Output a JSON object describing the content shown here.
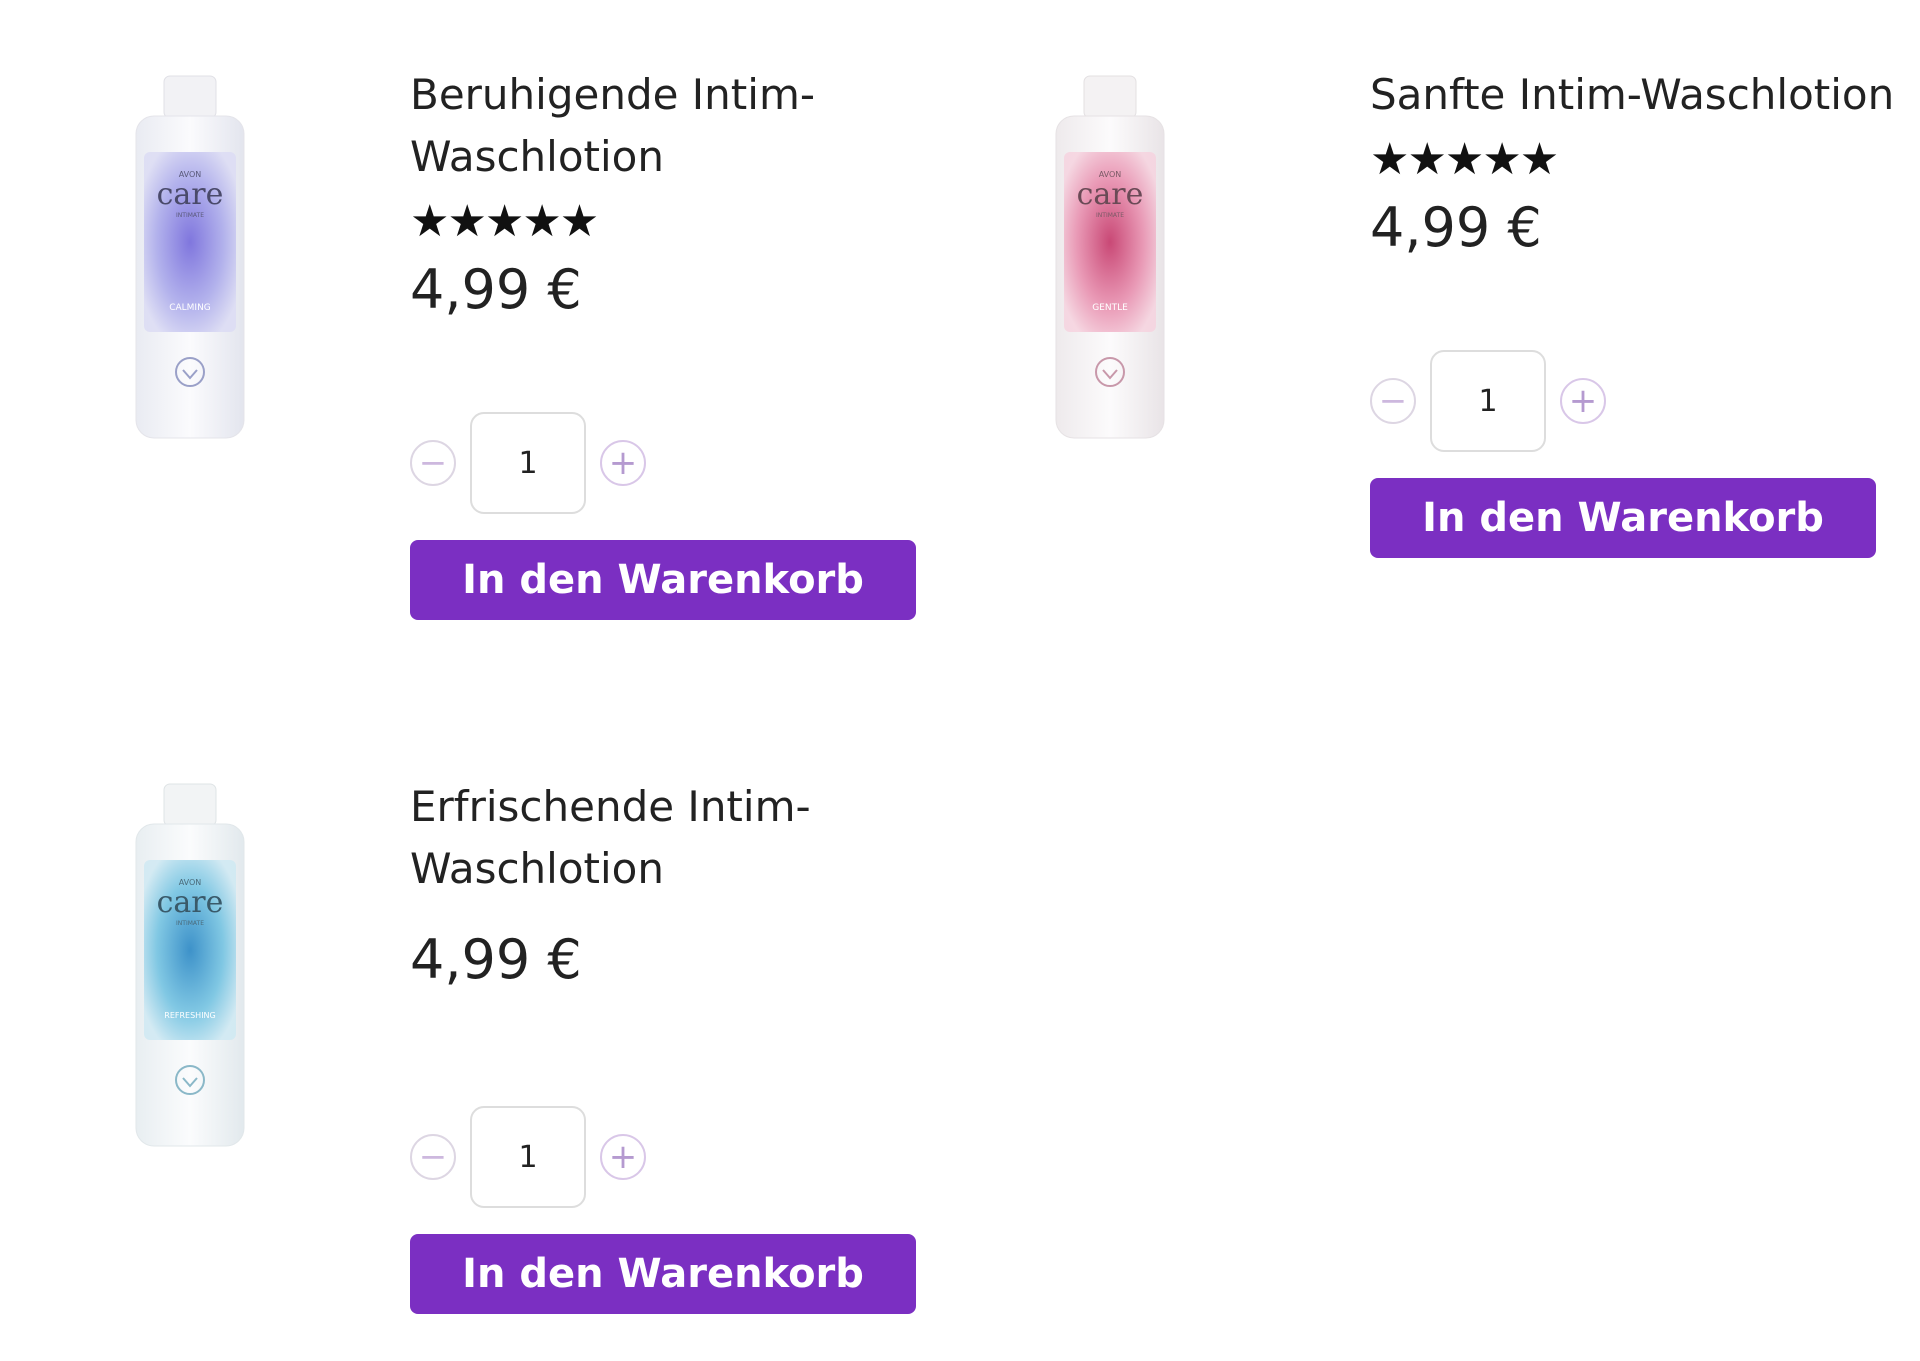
{
  "products": [
    {
      "title": "Beruhigende Intim-Waschlotion",
      "stars": "★★★★★",
      "rating": 5,
      "price": "4,99 €",
      "quantity": "1",
      "cart_label": "In den Warenkorb",
      "bottle_brand": "AVON",
      "bottle_logo": "care",
      "bottle_sub": "INTIMATE",
      "bottle_variant": "CALMING",
      "accent_color": "#7c7fe0"
    },
    {
      "title": "Sanfte Intim-Waschlotion",
      "stars": "★★★★★",
      "rating": 5,
      "price": "4,99 €",
      "quantity": "1",
      "cart_label": "In den Warenkorb",
      "bottle_brand": "AVON",
      "bottle_logo": "care",
      "bottle_sub": "INTIMATE",
      "bottle_variant": "GENTLE",
      "accent_color": "#d9477a"
    },
    {
      "title": "Erfrischende Intim-Waschlotion",
      "stars": "",
      "price": "4,99 €",
      "quantity": "1",
      "cart_label": "In den Warenkorb",
      "bottle_brand": "AVON",
      "bottle_logo": "care",
      "bottle_sub": "INTIMATE",
      "bottle_variant": "REFRESHING",
      "accent_color": "#2a9bd0"
    }
  ],
  "colors": {
    "primary": "#7b2fc2",
    "text": "#222222"
  },
  "icons": {
    "minus": "minus-circle-icon",
    "plus": "plus-circle-icon"
  }
}
